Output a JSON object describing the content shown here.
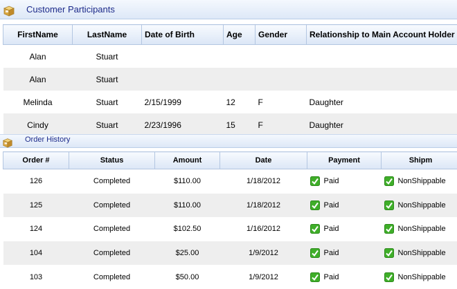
{
  "customer_panel": {
    "title": "Customer Participants",
    "icon": "box-icon"
  },
  "customer_table": {
    "columns": [
      "FirstName",
      "LastName",
      "Date of Birth",
      "Age",
      "Gender",
      "Relationship to Main Account Holder"
    ],
    "rows": [
      [
        "Alan",
        "Stuart",
        "",
        "",
        "",
        ""
      ],
      [
        "Alan",
        "Stuart",
        "",
        "",
        "",
        ""
      ],
      [
        "Melinda",
        "Stuart",
        "2/15/1999",
        "12",
        "F",
        "Daughter"
      ],
      [
        "Cindy",
        "Stuart",
        "2/23/1996",
        "15",
        "F",
        "Daughter"
      ]
    ]
  },
  "order_panel": {
    "title": "Order History",
    "icon": "box-icon"
  },
  "order_table": {
    "columns": [
      "Order #",
      "Status",
      "Amount",
      "Date",
      "Payment",
      "Shipm"
    ],
    "rows": [
      [
        "126",
        "Completed",
        "$110.00",
        "1/18/2012",
        "Paid",
        "NonShippable"
      ],
      [
        "125",
        "Completed",
        "$110.00",
        "1/18/2012",
        "Paid",
        "NonShippable"
      ],
      [
        "124",
        "Completed",
        "$102.50",
        "1/16/2012",
        "Paid",
        "NonShippable"
      ],
      [
        "104",
        "Completed",
        "$25.00",
        "1/9/2012",
        "Paid",
        "NonShippable"
      ],
      [
        "103",
        "Completed",
        "$50.00",
        "1/9/2012",
        "Paid",
        "NonShippable"
      ]
    ],
    "status_icon": "check-icon"
  },
  "colors": {
    "title_text": "#1c2a8a",
    "header_border": "#b3c6e1",
    "alt_row": "#eeeeee",
    "check_green": "#3fae29"
  }
}
